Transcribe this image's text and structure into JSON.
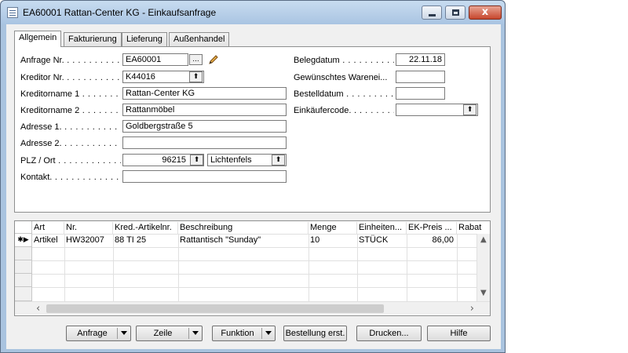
{
  "window": {
    "title": "EA60001 Rattan-Center KG - Einkaufsanfrage",
    "close_glyph": "x"
  },
  "tabs": [
    {
      "label": "Allgemein",
      "active": true
    },
    {
      "label": "Fakturierung",
      "active": false
    },
    {
      "label": "Lieferung",
      "active": false
    },
    {
      "label": "Außenhandel",
      "active": false
    }
  ],
  "form": {
    "left": {
      "anfrage_nr": {
        "label": "Anfrage Nr.",
        "value": "EA60001",
        "button": "..."
      },
      "kreditor_nr": {
        "label": "Kreditor Nr.",
        "value": "K44016",
        "button": "⬆"
      },
      "kreditorname1": {
        "label": "Kreditorname 1",
        "value": "Rattan-Center KG"
      },
      "kreditorname2": {
        "label": "Kreditorname 2",
        "value": "Rattanmöbel"
      },
      "adresse1": {
        "label": "Adresse 1.",
        "value": "Goldbergstraße 5"
      },
      "adresse2": {
        "label": "Adresse 2.",
        "value": ""
      },
      "plz_ort": {
        "label": "PLZ / Ort",
        "plz": "96215",
        "ort": "Lichtenfels",
        "button": "⬆"
      },
      "kontakt": {
        "label": "Kontakt.",
        "value": ""
      }
    },
    "right": {
      "belegdatum": {
        "label": "Belegdatum",
        "value": "22.11.18"
      },
      "gew_warenein": {
        "label": "Gewünschtes Warenei...",
        "value": ""
      },
      "bestelldatum": {
        "label": "Bestelldatum",
        "value": ""
      },
      "einkaeufercode": {
        "label": "Einkäufercode.",
        "value": "",
        "button": "⬆"
      }
    }
  },
  "lines": {
    "columns": [
      "Art",
      "Nr.",
      "Kred.-Artikelnr.",
      "Beschreibung",
      "Menge",
      "Einheiten...",
      "EK-Preis ...",
      "Rabat"
    ],
    "rows": [
      {
        "marker": "✱▶",
        "art": "Artikel",
        "nr": "HW32007",
        "kred": "88 TI 25",
        "beschreibung": "Rattantisch \"Sunday\"",
        "menge": "10",
        "einheit": "STÜCK",
        "preis": "86,00",
        "rabatt": ""
      }
    ],
    "scroll": {
      "up": "▲",
      "down": "▼",
      "left": "‹",
      "right": "›"
    }
  },
  "buttons": {
    "anfrage": "Anfrage",
    "zeile": "Zeile",
    "funktion": "Funktion",
    "bestellung": "Bestellung erst.",
    "drucken": "Drucken...",
    "hilfe": "Hilfe"
  },
  "colors": {
    "window_frame": "#a9c3df",
    "client": "#f0f0f0",
    "close_button": "#c7462c"
  }
}
